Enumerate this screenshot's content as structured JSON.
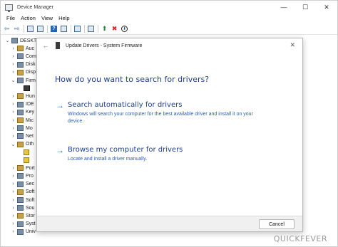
{
  "window": {
    "title": "Device Manager"
  },
  "window_controls": {
    "minimize": "—",
    "maximize": "☐",
    "close": "✕"
  },
  "menu": [
    "File",
    "Action",
    "View",
    "Help"
  ],
  "toolbar": {
    "back": "⇦",
    "forward": "⇨",
    "remove": "✖",
    "download": "⬇",
    "enable": "⬆"
  },
  "tree": {
    "items": [
      {
        "caret": "⌄",
        "label": "DESKTO",
        "icon": "computer-icon"
      },
      {
        "caret": "›",
        "label": "Auc",
        "icon": "audio-icon"
      },
      {
        "caret": "›",
        "label": "Com",
        "icon": "computer-icon"
      },
      {
        "caret": "›",
        "label": "Disk",
        "icon": "disk-icon"
      },
      {
        "caret": "›",
        "label": "Disp",
        "icon": "display-icon"
      },
      {
        "caret": "⌄",
        "label": "Firm",
        "icon": "firmware-icon"
      },
      {
        "caret": "",
        "label": "",
        "icon": "firmware-device-icon"
      },
      {
        "caret": "›",
        "label": "Hun",
        "icon": "hid-icon"
      },
      {
        "caret": "›",
        "label": "IDE",
        "icon": "ide-icon"
      },
      {
        "caret": "›",
        "label": "Key",
        "icon": "keyboard-icon"
      },
      {
        "caret": "›",
        "label": "Mic",
        "icon": "mice-icon"
      },
      {
        "caret": "›",
        "label": "Mo",
        "icon": "monitor-icon"
      },
      {
        "caret": "›",
        "label": "Net",
        "icon": "network-icon"
      },
      {
        "caret": "⌄",
        "label": "Oth",
        "icon": "other-devices-icon"
      },
      {
        "caret": "",
        "label": "",
        "icon": "warning-device-icon"
      },
      {
        "caret": "",
        "label": "",
        "icon": "warning-device-icon"
      },
      {
        "caret": "›",
        "label": "Port",
        "icon": "ports-icon"
      },
      {
        "caret": "›",
        "label": "Pro",
        "icon": "processor-icon"
      },
      {
        "caret": "›",
        "label": "Sec",
        "icon": "security-icon"
      },
      {
        "caret": "›",
        "label": "Soft",
        "icon": "software-icon"
      },
      {
        "caret": "›",
        "label": "Soft",
        "icon": "software-icon"
      },
      {
        "caret": "›",
        "label": "Sou",
        "icon": "sound-icon"
      },
      {
        "caret": "›",
        "label": "Stor",
        "icon": "storage-icon"
      },
      {
        "caret": "›",
        "label": "Syst",
        "icon": "system-icon"
      },
      {
        "caret": "›",
        "label": "Univ",
        "icon": "usb-icon"
      }
    ]
  },
  "dialog": {
    "back": "←",
    "title": "Update Drivers - System Firmware",
    "close": "✕",
    "heading": "How do you want to search for drivers?",
    "options": [
      {
        "arrow": "→",
        "title": "Search automatically for drivers",
        "description": "Windows will search your computer for the best available driver and install it on your device."
      },
      {
        "arrow": "→",
        "title": "Browse my computer for drivers",
        "description": "Locate and install a driver manually."
      }
    ],
    "cancel_label": "Cancel"
  },
  "watermark": "QUICKFEVER",
  "colors": {
    "link_blue": "#1f3f8a",
    "desc_blue": "#2a5db0",
    "arrow_blue": "#1b69c9"
  }
}
